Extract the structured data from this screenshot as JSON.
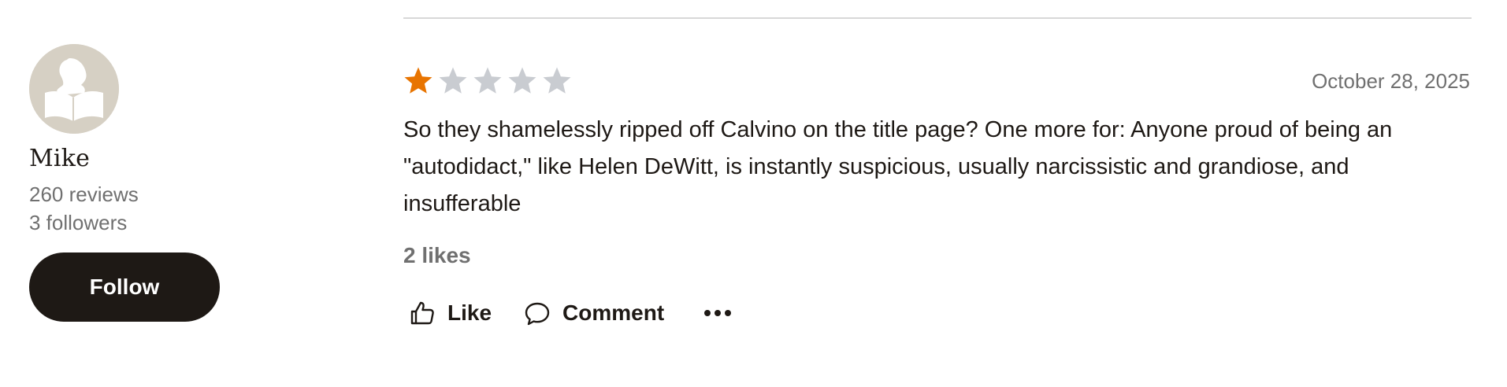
{
  "reviewer": {
    "name": "Mike",
    "reviews": "260 reviews",
    "followers": "3 followers",
    "follow_label": "Follow",
    "avatar_icon": "reader-silhouette-icon"
  },
  "review": {
    "rating": 1,
    "max_rating": 5,
    "date": "October 28, 2025",
    "text": "So they shamelessly ripped off Calvino on the title page? One more for: Anyone proud of being an \"autodidact,\" like Helen DeWitt, is instantly suspicious, usually narcissistic and grandiose, and insufferable",
    "likes": "2 likes"
  },
  "actions": {
    "like_label": "Like",
    "comment_label": "Comment",
    "like_icon": "thumbs-up-icon",
    "comment_icon": "speech-bubble-icon",
    "more_icon": "more-dots-icon"
  },
  "colors": {
    "star_filled": "#e87400",
    "star_empty": "#c9ccd1",
    "text_primary": "#1e1915",
    "text_muted": "#707070",
    "button_dark": "#1e1915"
  }
}
